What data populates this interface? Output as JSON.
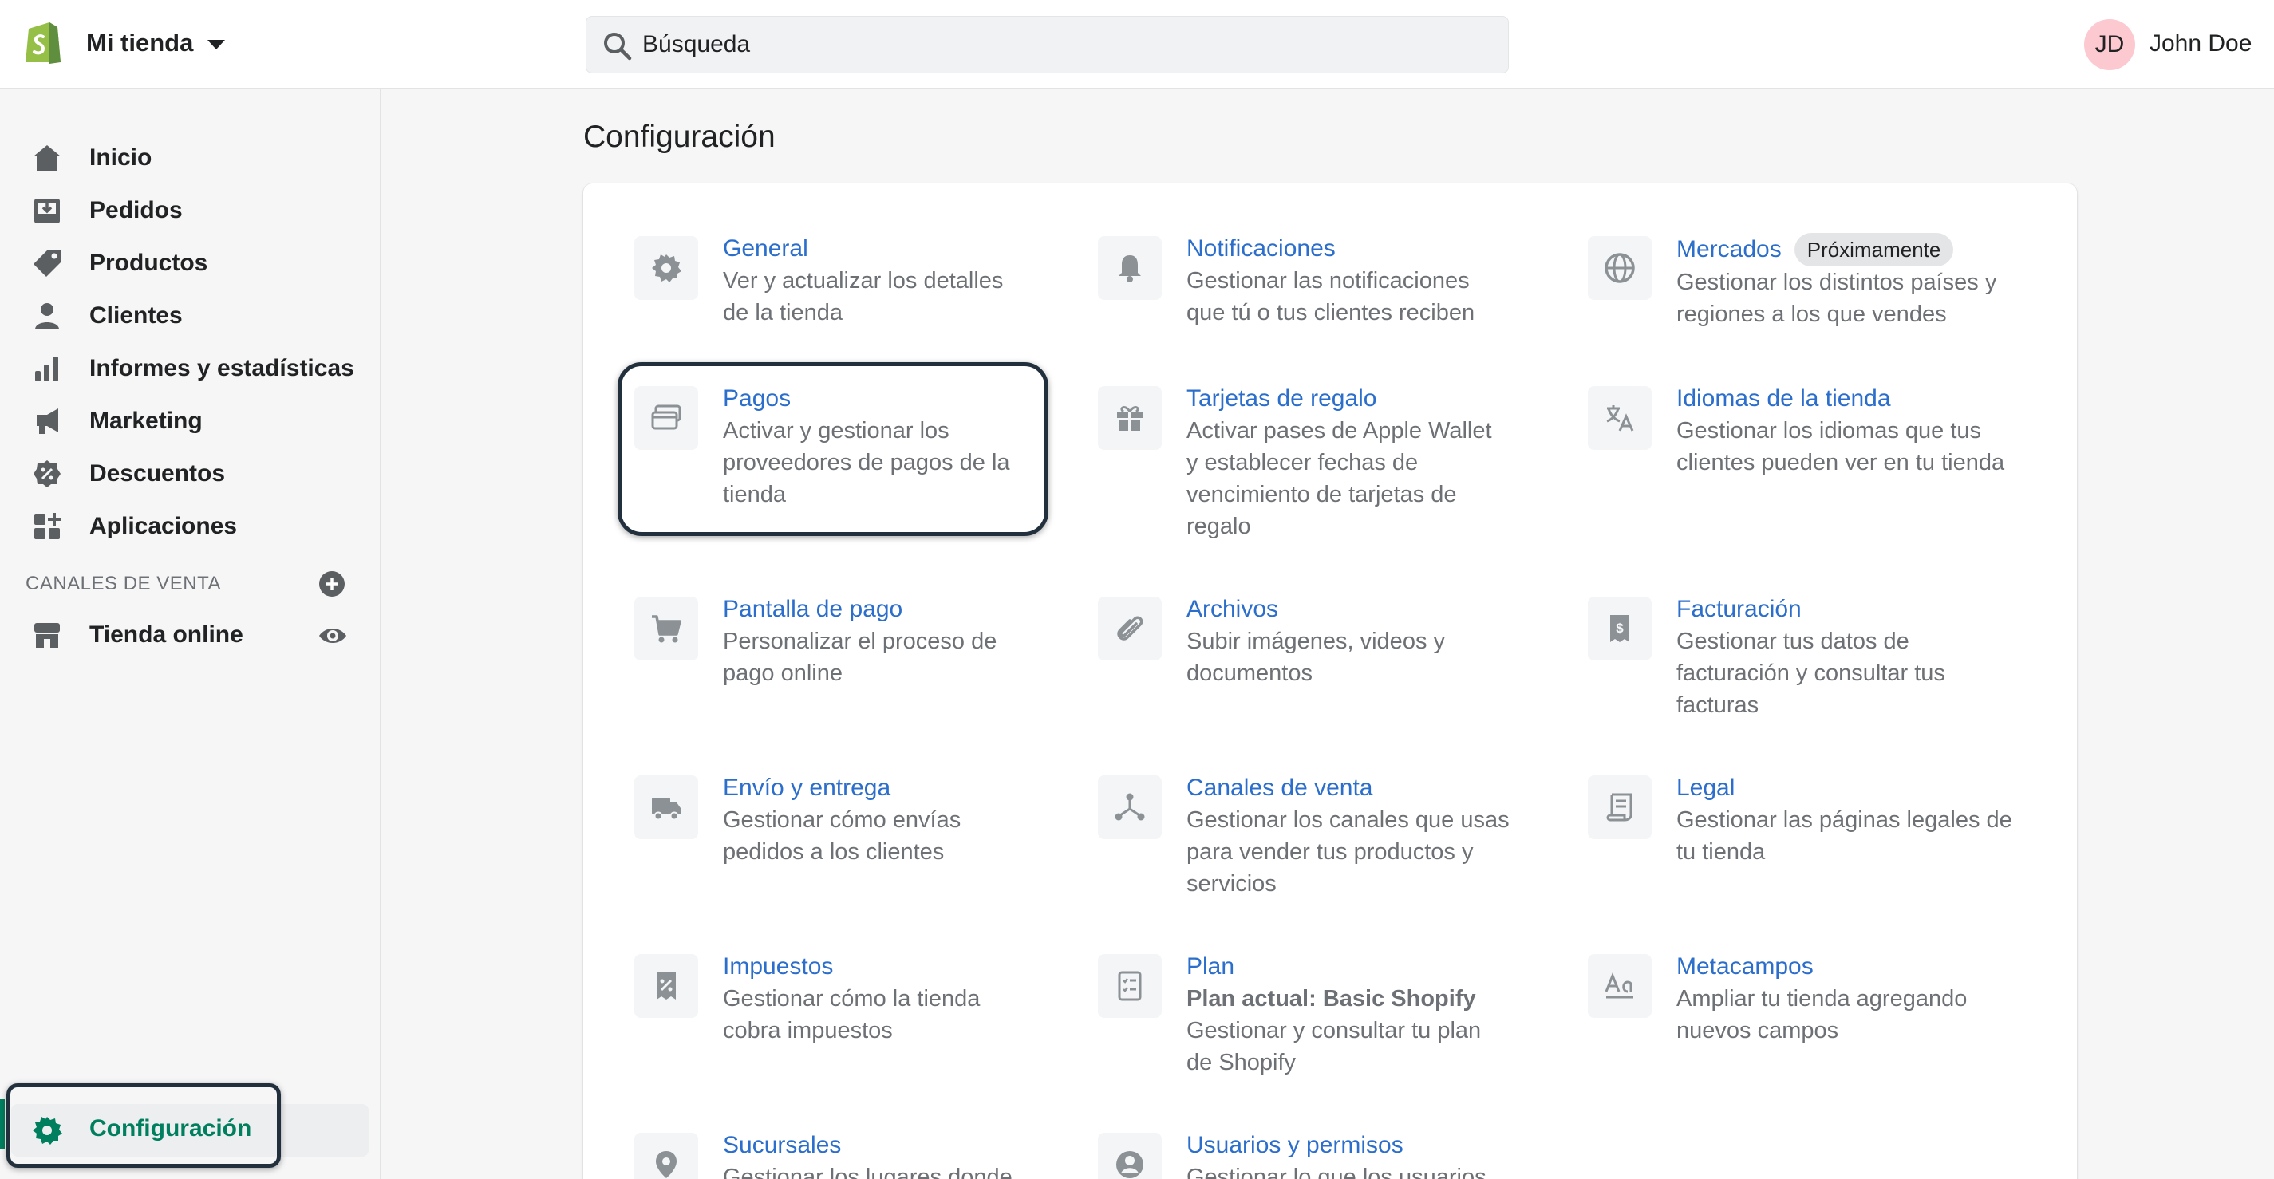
{
  "topbar": {
    "store_name": "Mi tienda",
    "search_placeholder": "Búsqueda",
    "avatar_initials": "JD",
    "user_name": "John Doe"
  },
  "sidebar": {
    "items": [
      {
        "label": "Inicio",
        "icon": "home-icon"
      },
      {
        "label": "Pedidos",
        "icon": "orders-icon"
      },
      {
        "label": "Productos",
        "icon": "tag-icon"
      },
      {
        "label": "Clientes",
        "icon": "person-icon"
      },
      {
        "label": "Informes y estadísticas",
        "icon": "bar-chart-icon"
      },
      {
        "label": "Marketing",
        "icon": "megaphone-icon"
      },
      {
        "label": "Descuentos",
        "icon": "discount-icon"
      },
      {
        "label": "Aplicaciones",
        "icon": "apps-icon"
      }
    ],
    "sales_channels_title": "CANALES DE VENTA",
    "online_store_label": "Tienda online",
    "settings_label": "Configuración"
  },
  "main": {
    "title": "Configuración",
    "settings": [
      {
        "title": "General",
        "desc": [
          "Ver y actualizar los detalles",
          "de la tienda"
        ],
        "icon": "gear-icon"
      },
      {
        "title": "Notificaciones",
        "desc": [
          "Gestionar las notificaciones",
          "que tú o tus clientes reciben"
        ],
        "icon": "bell-icon"
      },
      {
        "title": "Mercados",
        "badge": "Próximamente",
        "desc": [
          "Gestionar los distintos países y",
          "regiones a los que vendes"
        ],
        "icon": "globe-icon"
      },
      {
        "title": "Pagos",
        "desc": [
          "Activar y gestionar los",
          "proveedores de pagos de la",
          "tienda"
        ],
        "icon": "payment-icon"
      },
      {
        "title": "Tarjetas de regalo",
        "desc": [
          "Activar pases de Apple Wallet",
          "y establecer fechas de",
          "vencimiento de tarjetas de",
          "regalo"
        ],
        "icon": "gift-icon"
      },
      {
        "title": "Idiomas de la tienda",
        "desc": [
          "Gestionar los idiomas que tus",
          "clientes pueden ver en tu tienda"
        ],
        "icon": "translate-icon"
      },
      {
        "title": "Pantalla de pago",
        "desc": [
          "Personalizar el proceso de",
          "pago online"
        ],
        "icon": "cart-icon"
      },
      {
        "title": "Archivos",
        "desc": [
          "Subir imágenes, videos y",
          "documentos"
        ],
        "icon": "paperclip-icon"
      },
      {
        "title": "Facturación",
        "desc": [
          "Gestionar tus datos de",
          "facturación y consultar tus",
          "facturas"
        ],
        "icon": "billing-icon"
      },
      {
        "title": "Envío y entrega",
        "desc": [
          "Gestionar cómo envías",
          "pedidos a los clientes"
        ],
        "icon": "truck-icon"
      },
      {
        "title": "Canales de venta",
        "desc": [
          "Gestionar los canales que usas",
          "para vender tus productos y",
          "servicios"
        ],
        "icon": "channels-icon"
      },
      {
        "title": "Legal",
        "desc": [
          "Gestionar las páginas legales de",
          "tu tienda"
        ],
        "icon": "document-icon"
      },
      {
        "title": "Impuestos",
        "desc": [
          "Gestionar cómo la tienda",
          "cobra impuestos"
        ],
        "icon": "tax-icon"
      },
      {
        "title": "Plan",
        "desc_bold": "Plan actual: Basic Shopify",
        "desc": [
          "Gestionar y consultar tu plan",
          "de Shopify"
        ],
        "icon": "checklist-icon"
      },
      {
        "title": "Metacampos",
        "desc": [
          "Ampliar tu tienda agregando",
          "nuevos campos"
        ],
        "icon": "metafields-icon"
      },
      {
        "title": "Sucursales",
        "desc": [
          "Gestionar los lugares donde"
        ],
        "icon": "location-icon"
      },
      {
        "title": "Usuarios y permisos",
        "desc": [
          "Gestionar lo que los usuarios"
        ],
        "icon": "user-circle-icon"
      }
    ]
  },
  "colors": {
    "link": "#2c6ecb",
    "active": "#007f5f",
    "badge_bg": "#e4e5e7",
    "avatar_bg": "#fdc9d0"
  }
}
